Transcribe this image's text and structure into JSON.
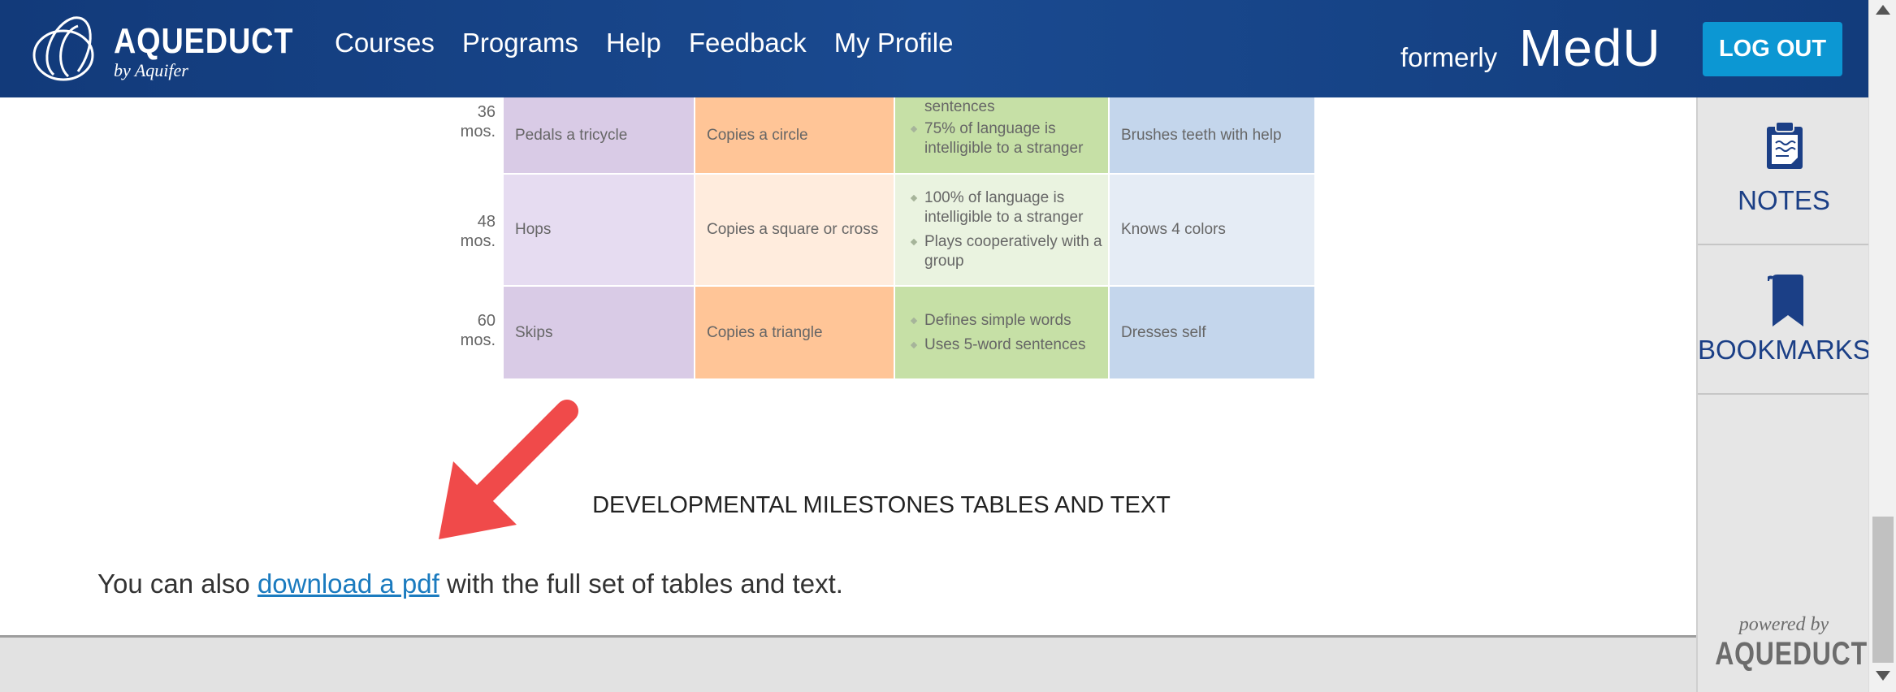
{
  "header": {
    "logo_main": "AQUEDUCT",
    "logo_sub": "by Aquifer",
    "nav": [
      "Courses",
      "Programs",
      "Help",
      "Feedback",
      "My Profile"
    ],
    "formerly": "formerly",
    "brand": "MedU",
    "logout": "LOG OUT",
    "colors": {
      "bar": "#123a7a",
      "logout": "#0c97d3"
    }
  },
  "milestones": {
    "column_colors": [
      "#d9cbe6",
      "#ffc597",
      "#c6e0a6",
      "#c4d6ec"
    ],
    "rows": [
      {
        "age": "36",
        "unit": "mos.",
        "gross_motor": "Pedals a tricycle",
        "fine_motor": "Copies a circle",
        "language": [
          "sentences",
          "75% of language is intelligible to a stranger"
        ],
        "social": "Brushes teeth with help"
      },
      {
        "age": "48",
        "unit": "mos.",
        "gross_motor": "Hops",
        "fine_motor": "Copies a square or cross",
        "language": [
          "100% of language is intelligible to a stranger",
          "Plays cooperatively with a group"
        ],
        "social": "Knows 4 colors"
      },
      {
        "age": "60",
        "unit": "mos.",
        "gross_motor": "Skips",
        "fine_motor": "Copies a triangle",
        "language": [
          "Defines simple words",
          "Uses 5-word sentences"
        ],
        "social": "Dresses self"
      }
    ]
  },
  "content": {
    "section_title": "DEVELOPMENTAL MILESTONES TABLES AND TEXT",
    "para_before": "You can also ",
    "para_link": "download a pdf",
    "para_after": " with the full set of tables and text."
  },
  "sidebar": {
    "notes": "NOTES",
    "bookmarks": "BOOKMARKS",
    "powered_by": "powered by",
    "powered_brand": "AQUEDUCT"
  }
}
